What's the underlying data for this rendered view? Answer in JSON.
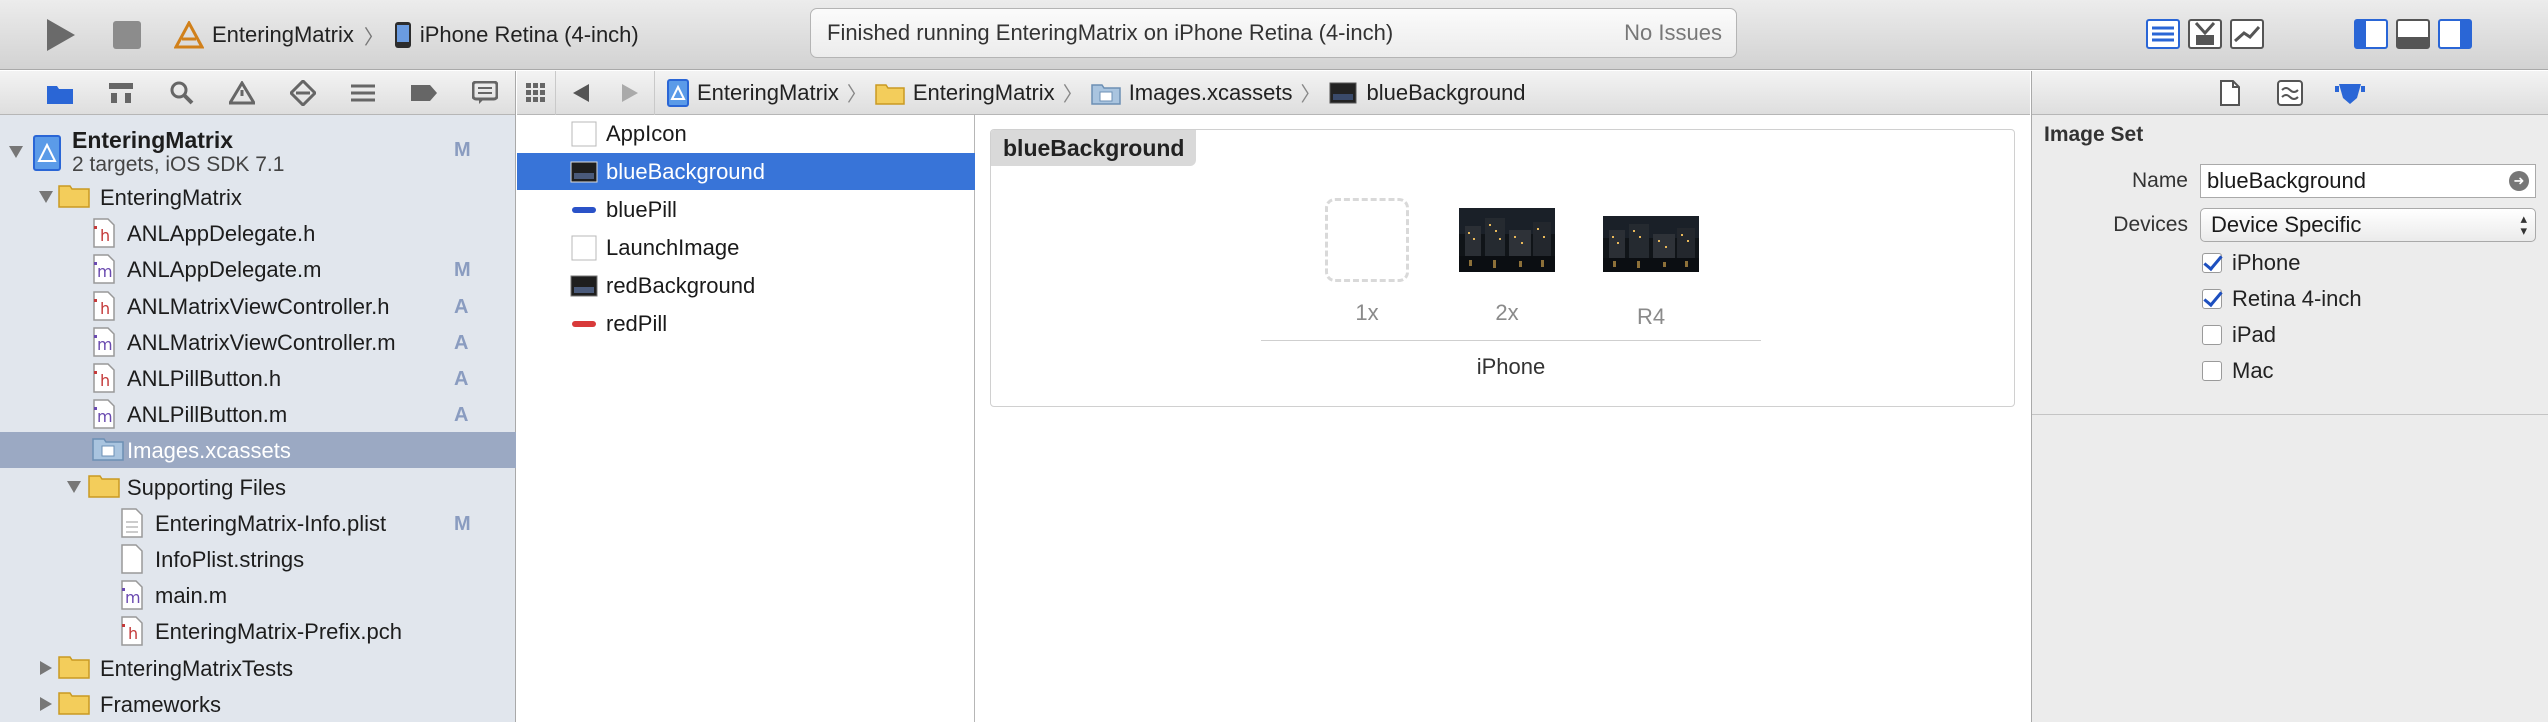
{
  "toolbar": {
    "scheme_project": "EnteringMatrix",
    "scheme_device": "iPhone Retina (4-inch)",
    "activity_status": "Finished running EnteringMatrix on iPhone Retina (4-inch)",
    "activity_issues": "No Issues"
  },
  "navigator": {
    "project": {
      "name": "EnteringMatrix",
      "subtitle": "2 targets, iOS SDK 7.1",
      "badge": "M"
    },
    "items": [
      {
        "label": "EnteringMatrix",
        "type": "folder",
        "badge": ""
      },
      {
        "label": "ANLAppDelegate.h",
        "type": "h",
        "badge": ""
      },
      {
        "label": "ANLAppDelegate.m",
        "type": "m",
        "badge": "M"
      },
      {
        "label": "ANLMatrixViewController.h",
        "type": "h",
        "badge": "A"
      },
      {
        "label": "ANLMatrixViewController.m",
        "type": "m",
        "badge": "A"
      },
      {
        "label": "ANLPillButton.h",
        "type": "h",
        "badge": "A"
      },
      {
        "label": "ANLPillButton.m",
        "type": "m",
        "badge": "A"
      },
      {
        "label": "Images.xcassets",
        "type": "xcassets",
        "badge": ""
      },
      {
        "label": "Supporting Files",
        "type": "folder",
        "badge": ""
      },
      {
        "label": "EnteringMatrix-Info.plist",
        "type": "plist",
        "badge": "M"
      },
      {
        "label": "InfoPlist.strings",
        "type": "strings",
        "badge": ""
      },
      {
        "label": "main.m",
        "type": "m",
        "badge": ""
      },
      {
        "label": "EnteringMatrix-Prefix.pch",
        "type": "h",
        "badge": ""
      },
      {
        "label": "EnteringMatrixTests",
        "type": "folder",
        "badge": ""
      },
      {
        "label": "Frameworks",
        "type": "folder",
        "badge": ""
      }
    ]
  },
  "jumpbar": {
    "crumbs": [
      "EnteringMatrix",
      "EnteringMatrix",
      "Images.xcassets",
      "blueBackground"
    ]
  },
  "assets": {
    "items": [
      "AppIcon",
      "blueBackground",
      "bluePill",
      "LaunchImage",
      "redBackground",
      "redPill"
    ],
    "selected": "blueBackground"
  },
  "imageset": {
    "title": "blueBackground",
    "slots": [
      "1x",
      "2x",
      "R4"
    ],
    "device_group": "iPhone"
  },
  "inspector": {
    "section_title": "Image Set",
    "name_label": "Name",
    "name_value": "blueBackground",
    "devices_label": "Devices",
    "devices_value": "Device Specific",
    "checkboxes": [
      {
        "label": "iPhone",
        "checked": true
      },
      {
        "label": "Retina 4-inch",
        "checked": true
      },
      {
        "label": "iPad",
        "checked": false
      },
      {
        "label": "Mac",
        "checked": false
      }
    ]
  },
  "colors": {
    "selection_blue": "#3874d8",
    "navigator_selection": "#9ba9c3",
    "navigator_bg": "#e1e6ed",
    "badge_color": "#8a9cc0"
  }
}
